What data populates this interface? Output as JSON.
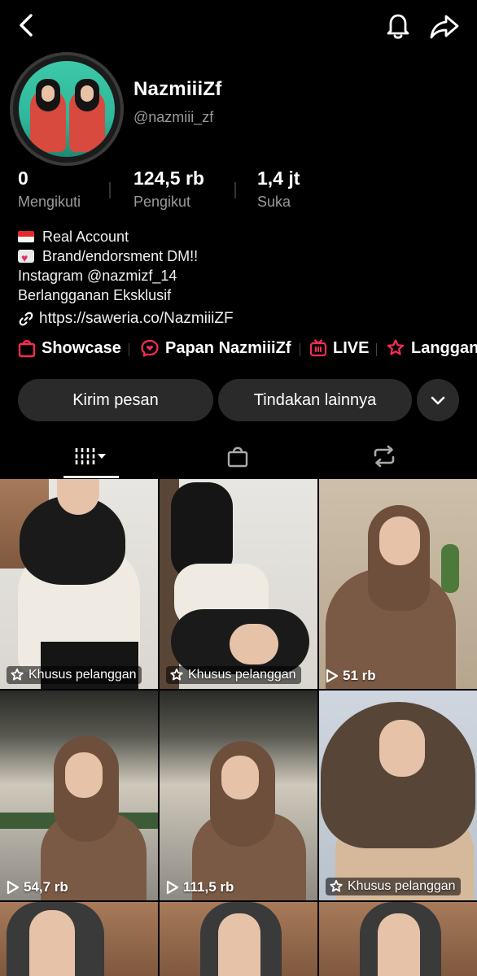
{
  "header": {
    "back_icon": "back-chevron-icon",
    "bell_icon": "bell-icon",
    "share_icon": "share-arrow-icon"
  },
  "profile": {
    "name": "NazmiiiZf",
    "handle": "@nazmiii_zf"
  },
  "stats": [
    {
      "value": "0",
      "label": "Mengikuti"
    },
    {
      "value": "124,5 rb",
      "label": "Pengikut"
    },
    {
      "value": "1,4 jt",
      "label": "Suka"
    }
  ],
  "bio": {
    "line1": "Real Account",
    "line2": "Brand/endorsment DM!!",
    "line3": "Instagram @nazmizf_14",
    "line4": "Berlangganan Eksklusif",
    "link": "https://saweria.co/NazmiiiZF"
  },
  "tools": [
    {
      "label": "Showcase",
      "icon": "shopping-bag-icon"
    },
    {
      "label": "Papan NazmiiiZf",
      "icon": "chat-heart-icon"
    },
    {
      "label": "LIVE",
      "icon": "live-tv-icon"
    },
    {
      "label": "Langgan",
      "icon": "subscribe-star-icon"
    }
  ],
  "buttons": {
    "message": "Kirim pesan",
    "more_actions": "Tindakan lainnya"
  },
  "tabs": [
    "videos-grid-icon",
    "shop-bag-icon",
    "repost-icon"
  ],
  "videos": [
    {
      "badge": "Khusus pelanggan"
    },
    {
      "badge": "Khusus pelanggan"
    },
    {
      "views": "51 rb"
    },
    {
      "views": "54,7 rb"
    },
    {
      "views": "111,5 rb"
    },
    {
      "badge": "Khusus pelanggan"
    }
  ],
  "colors": {
    "accent_red": "#fe2c55",
    "background": "#000000",
    "button_bg": "#2a2a2a",
    "muted_text": "#9a9a9a"
  }
}
